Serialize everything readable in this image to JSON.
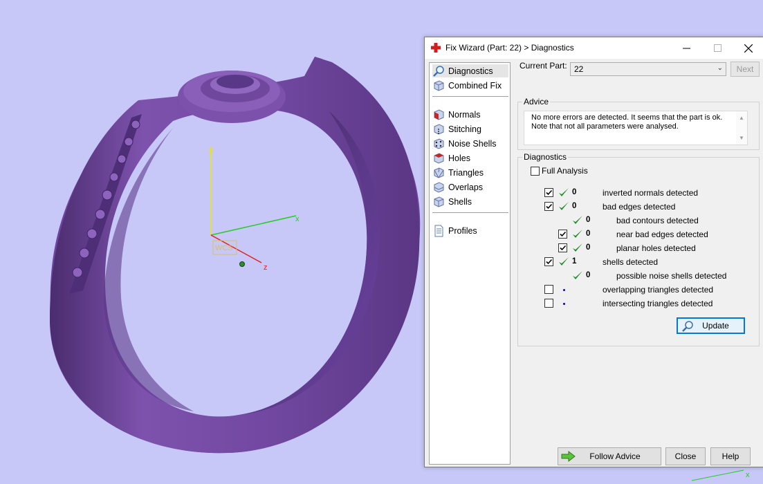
{
  "window": {
    "title": "Fix Wizard (Part: 22) > Diagnostics"
  },
  "nav": {
    "group1": [
      {
        "label": "Diagnostics",
        "icon": "magnifier-icon",
        "selected": true
      },
      {
        "label": "Combined Fix",
        "icon": "cube-icon"
      }
    ],
    "group2": [
      {
        "label": "Normals",
        "icon": "normals-icon"
      },
      {
        "label": "Stitching",
        "icon": "stitching-icon"
      },
      {
        "label": "Noise Shells",
        "icon": "noise-shells-icon"
      },
      {
        "label": "Holes",
        "icon": "holes-icon"
      },
      {
        "label": "Triangles",
        "icon": "triangles-icon"
      },
      {
        "label": "Overlaps",
        "icon": "overlaps-icon"
      },
      {
        "label": "Shells",
        "icon": "shells-icon"
      }
    ],
    "group3": [
      {
        "label": "Profiles",
        "icon": "document-icon"
      }
    ]
  },
  "current_part": {
    "label": "Current Part:",
    "value": "22",
    "next_label": "Next"
  },
  "advice": {
    "title": "Advice",
    "line1": "No more errors are detected. It seems that the part is ok.",
    "line2": "Note that not all parameters were analysed."
  },
  "diagnostics": {
    "title": "Diagnostics",
    "full_analysis_label": "Full Analysis",
    "rows": [
      {
        "checked": true,
        "status": "ok",
        "count": "0",
        "label": "inverted normals detected",
        "indent": 0
      },
      {
        "checked": true,
        "status": "ok",
        "count": "0",
        "label": "bad edges detected",
        "indent": 0
      },
      {
        "checked": null,
        "status": "ok",
        "count": "0",
        "label": "bad contours detected",
        "indent": 1
      },
      {
        "checked": true,
        "status": "ok",
        "count": "0",
        "label": "near bad edges detected",
        "indent": 1
      },
      {
        "checked": true,
        "status": "ok",
        "count": "0",
        "label": "planar holes detected",
        "indent": 1
      },
      {
        "checked": true,
        "status": "ok",
        "count": "1",
        "label": "shells detected",
        "indent": 0
      },
      {
        "checked": null,
        "status": "ok",
        "count": "0",
        "label": "possible noise shells detected",
        "indent": 1
      },
      {
        "checked": false,
        "status": "pending",
        "count": "",
        "label": "overlapping triangles detected",
        "indent": 0
      },
      {
        "checked": false,
        "status": "pending",
        "count": "",
        "label": "intersecting triangles detected",
        "indent": 0
      }
    ],
    "update_label": "Update"
  },
  "footer": {
    "follow_advice_label": "Follow Advice",
    "close_label": "Close",
    "help_label": "Help"
  },
  "viewport": {
    "axis_labels": {
      "x": "x",
      "y": "y",
      "z": "z"
    },
    "wcs_label": "WCS",
    "background": "#c8c8f8",
    "model_color": "#7a4fa8"
  }
}
